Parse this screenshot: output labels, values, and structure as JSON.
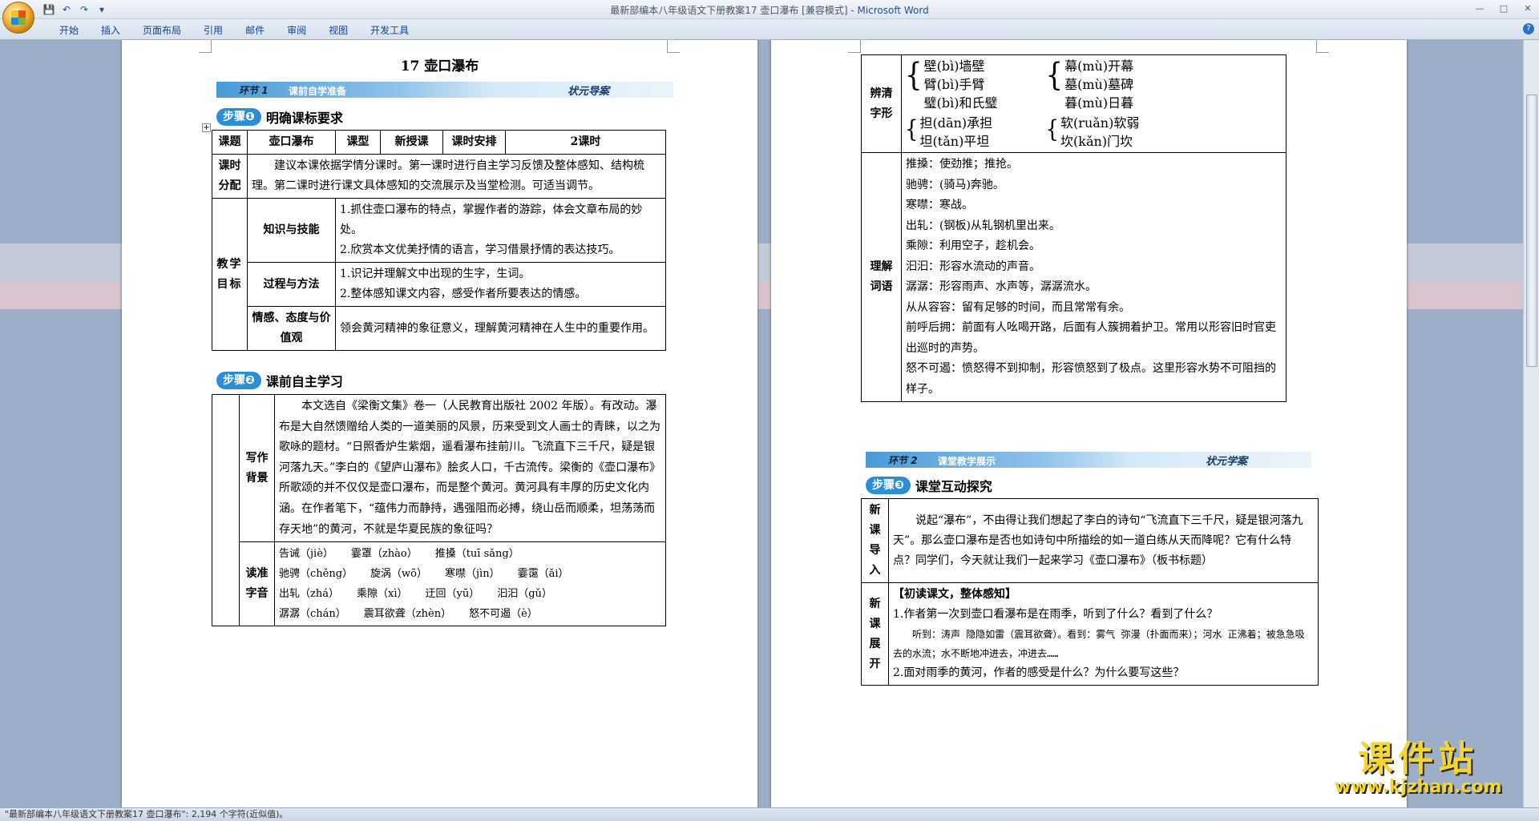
{
  "window": {
    "title": "最新部编本八年级语文下册教案17 壶口瀑布 [兼容模式] - ",
    "app_name": "Microsoft Word"
  },
  "ribbon": {
    "tabs": [
      "开始",
      "插入",
      "页面布局",
      "引用",
      "邮件",
      "审阅",
      "视图",
      "开发工具"
    ]
  },
  "status_bar": {
    "text": "\"最新部编本八年级语文下册教案17 壶口瀑布\": 2,194 个字符(近似值)。"
  },
  "page1": {
    "doc_title": "17  壶口瀑布",
    "banner1": {
      "tag": "环节",
      "num": "1",
      "text": "课前自学准备",
      "right": "状元导案"
    },
    "step1": {
      "pill": "步骤❶",
      "title": "明确课标要求"
    },
    "table1": {
      "row1": [
        "课题",
        "壶口瀑布",
        "课型",
        "新授课",
        "课时安排",
        "2课时"
      ],
      "time_label": "课时分配",
      "time_text": "建议本课依据学情分课时。第一课时进行自主学习反馈及整体感知、结构梳理。第二课时进行课文具体感知的交流展示及当堂检测。可适当调节。",
      "goal_label": "教学目标",
      "goals": [
        {
          "label": "知识与技能",
          "items": [
            "1.抓住壶口瀑布的特点，掌握作者的游踪，体会文章布局的妙处。",
            "2.欣赏本文优美抒情的语言，学习借景抒情的表达技巧。"
          ]
        },
        {
          "label": "过程与方法",
          "items": [
            "1.识记并理解文中出现的生字，生词。",
            "2.整体感知课文内容，感受作者所要表达的情感。"
          ]
        },
        {
          "label": "情感、态度与价值观",
          "items": [
            "领会黄河精神的象征意义，理解黄河精神在人生中的重要作用。"
          ]
        }
      ]
    },
    "step2": {
      "pill": "步骤❷",
      "title": "课前自主学习"
    },
    "table2": {
      "bg_label": "写作背景",
      "bg_text": "本文选自《梁衡文集》卷一（人民教育出版社 2002 年版）。有改动。瀑布是大自然馈赠给人类的一道美丽的风景，历来受到文人画士的青睐，以之为歌咏的题材。“日照香炉生紫烟，遥看瀑布挂前川。飞流直下三千尺，疑是银河落九天。”李白的《望庐山瀑布》脍炙人口，千古流传。梁衡的《壶口瀑布》所歌颂的并不仅仅是壶口瀑布，而是整个黄河。黄河具有丰厚的历史文化内涵。在作者笔下，“蕴伟力而静持，遇强阻而必搏，绕山岳而顺柔，坦荡荡而存天地”的黄河，不就是华夏民族的象征吗？",
      "pinyin_label": "读准字音",
      "pinyin_rows": [
        [
          "告诫（jiè）",
          "霎罩（zhào）",
          "推搡（tuī sǎng）"
        ],
        [
          "驰骋（chěng）",
          "旋涡（wō）",
          "寒噤（jìn）",
          "霎霭（ǎi）"
        ],
        [
          "出轧（zhá）",
          "乘隙（xì）",
          "迂回（yū）",
          "汩汩（gǔ）"
        ],
        [
          "潺潺（chán）",
          "震耳欲聋（zhèn）",
          "怒不可遏（è）"
        ]
      ]
    }
  },
  "page2": {
    "table3": {
      "shape_label": "辨清字形",
      "shape_left1": [
        "壁(bì)墙壁",
        "臂(bì)手臂",
        "璧(bì)和氏璧"
      ],
      "shape_right1": [
        "幕(mù)开幕",
        "墓(mù)墓碑",
        "暮(mù)日暮"
      ],
      "shape_left2": [
        "担(dān)承担",
        "坦(tǎn)平坦"
      ],
      "shape_right2": [
        "软(ruǎn)软弱",
        "坎(kǎn)门坎"
      ],
      "word_label": "理解词语",
      "words": [
        "推搡：使劲推；推抢。",
        "驰骋：(骑马)奔驰。",
        "寒噤：寒战。",
        "出轧：(钢板)从轧钢机里出来。",
        "乘隙：利用空子，趁机会。",
        "汩汩：形容水流动的声音。",
        "潺潺：形容雨声、水声等，潺潺流水。",
        "从从容容：留有足够的时间，而且常常有余。",
        "前呼后拥：前面有人吆喝开路，后面有人簇拥着护卫。常用以形容旧时官吏出巡时的声势。",
        "怒不可遏：愤怒得不到抑制，形容愤怒到了极点。这里形容水势不可阻挡的样子。"
      ]
    },
    "banner2": {
      "tag": "环节",
      "num": "2",
      "text": "课堂教学展示",
      "right": "状元学案"
    },
    "step3": {
      "pill": "步骤❸",
      "title": "课堂互动探究"
    },
    "table4": {
      "intro_label": "新课导入",
      "intro_text": "说起“瀑布”，不由得让我们想起了李白的诗句“飞流直下三千尺，疑是银河落九天”。那么壶口瀑布是否也如诗句中所描绘的如一道白练从天而降呢？它有什么特点？同学们，今天就让我们一起来学习《壶口瀑布》（板书标题）",
      "dev_label": "新课展开",
      "dev_head": "【初读课文，整体感知】",
      "dev_q1": "1.作者第一次到壶口看瀑布是在雨季，听到了什么？看到了什么？",
      "dev_a1": "听到：涛声 隐隐如雷（震耳欲聋）。看到：雾气 弥漫（扑面而来）；河水 正沸着；被急急吸去的水流；水不断地冲进去，冲进去……",
      "dev_q2": "2.面对雨季的黄河，作者的感受是什么？为什么要写这些？"
    }
  },
  "watermark": {
    "line1": "课件站",
    "line2": "www.kjzhan.com"
  }
}
